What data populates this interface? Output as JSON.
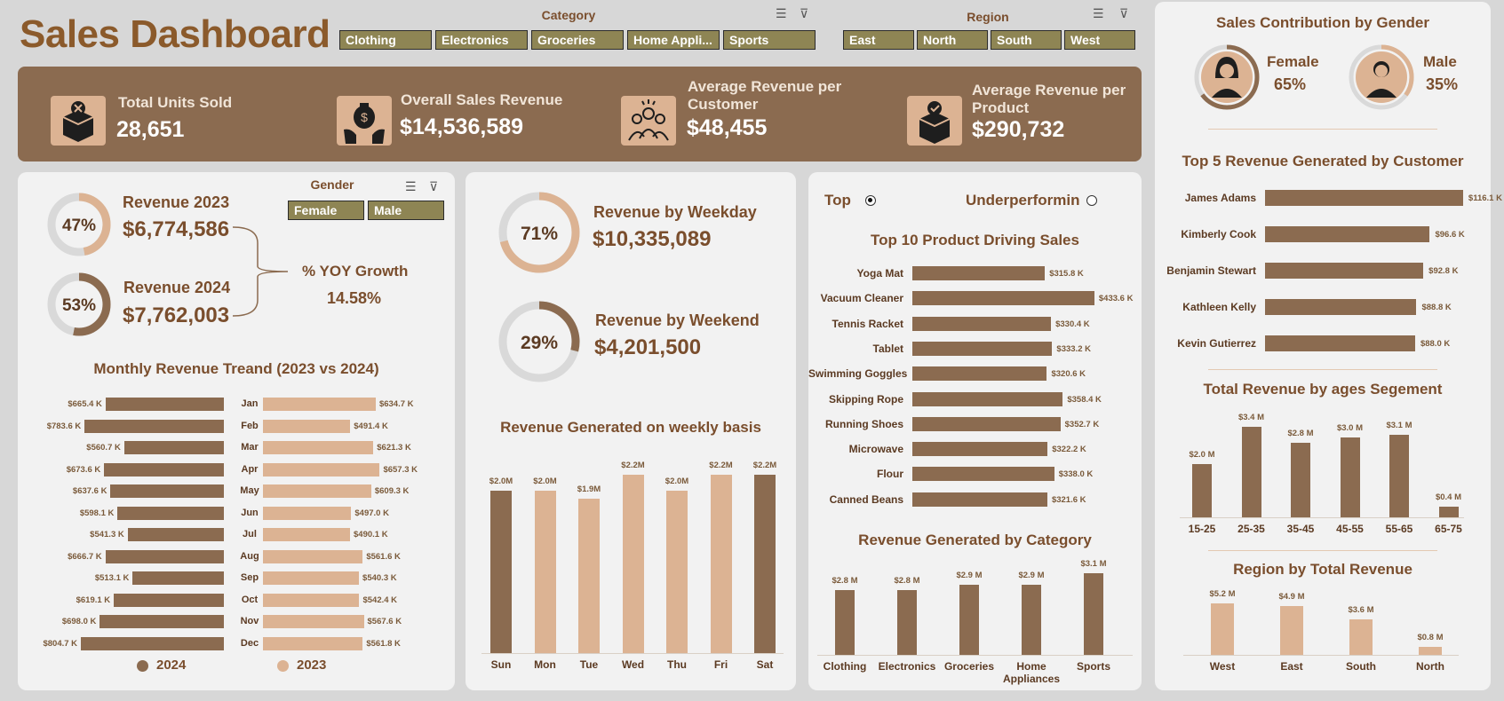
{
  "header": {
    "title": "Sales Dashboard"
  },
  "slicers": {
    "category": {
      "title": "Category",
      "items": [
        "Clothing",
        "Electronics",
        "Groceries",
        "Home Appli...",
        "Sports"
      ]
    },
    "region": {
      "title": "Region",
      "items": [
        "East",
        "North",
        "South",
        "West"
      ]
    },
    "gender": {
      "title": "Gender",
      "items": [
        "Female",
        "Male"
      ]
    }
  },
  "kpis": [
    {
      "label": "Total Units Sold",
      "value": "28,651",
      "icon": "box-cancel-icon"
    },
    {
      "label": "Overall Sales Revenue",
      "value": "$14,536,589",
      "icon": "money-bag-hands-icon"
    },
    {
      "label": "Average Revenue per Customer",
      "value": "$48,455",
      "icon": "customers-group-icon"
    },
    {
      "label": "Average Revenue per Product",
      "value": "$290,732",
      "icon": "box-check-icon"
    }
  ],
  "revenue_years": {
    "y2023": {
      "label": "Revenue 2023",
      "value": "$6,774,586",
      "pct": "47%",
      "fraction": 0.47
    },
    "y2024": {
      "label": "Revenue 2024",
      "value": "$7,762,003",
      "pct": "53%",
      "fraction": 0.53
    },
    "yoy": {
      "label": "%  YOY Growth",
      "value": "14.58%"
    }
  },
  "monthly": {
    "title": "Monthly Revenue Treand  (2023 vs 2024)",
    "legend": {
      "a": "2024",
      "b": "2023"
    },
    "chart_data": {
      "type": "bar",
      "categories": [
        "Jan",
        "Feb",
        "Mar",
        "Apr",
        "May",
        "Jun",
        "Jul",
        "Aug",
        "Sep",
        "Oct",
        "Nov",
        "Dec"
      ],
      "series": [
        {
          "name": "2024",
          "values": [
            665.4,
            783.6,
            560.7,
            673.6,
            637.6,
            598.1,
            541.3,
            666.7,
            513.1,
            619.1,
            698.0,
            804.7
          ],
          "labels": [
            "$665.4 K",
            "$783.6 K",
            "$560.7 K",
            "$673.6 K",
            "$637.6 K",
            "$598.1 K",
            "$541.3 K",
            "$666.7 K",
            "$513.1 K",
            "$619.1 K",
            "$698.0 K",
            "$804.7 K"
          ]
        },
        {
          "name": "2023",
          "values": [
            634.7,
            491.4,
            621.3,
            657.3,
            609.3,
            497.0,
            490.1,
            561.6,
            540.3,
            542.4,
            567.6,
            561.8
          ],
          "labels": [
            "$634.7 K",
            "$491.4 K",
            "$621.3 K",
            "$657.3 K",
            "$609.3 K",
            "$497.0 K",
            "$490.1 K",
            "$561.6 K",
            "$540.3 K",
            "$542.4 K",
            "$567.6 K",
            "$561.8 K"
          ]
        }
      ]
    }
  },
  "weekday": {
    "label": "Revenue by Weekday",
    "value": "$10,335,089",
    "pct": "71%",
    "fraction": 0.71
  },
  "weekend": {
    "label": "Revenue by Weekend",
    "value": "$4,201,500",
    "pct": "29%",
    "fraction": 0.29
  },
  "weekly": {
    "title": "Revenue Generated on weekly basis",
    "chart_data": {
      "type": "bar",
      "categories": [
        "Sun",
        "Mon",
        "Tue",
        "Wed",
        "Thu",
        "Fri",
        "Sat"
      ],
      "values": [
        2.0,
        2.0,
        1.9,
        2.2,
        2.0,
        2.2,
        2.2
      ],
      "labels": [
        "$2.0M",
        "$2.0M",
        "$1.9M",
        "$2.2M",
        "$2.0M",
        "$2.2M",
        "$2.2M"
      ],
      "colors": [
        "dark",
        "light",
        "light",
        "light",
        "light",
        "light",
        "dark"
      ]
    }
  },
  "products": {
    "toggle_top": "Top",
    "toggle_under": "Underperformin",
    "title": "Top 10 Product Driving Sales",
    "chart_data": {
      "type": "bar",
      "categories": [
        "Yoga Mat",
        "Vacuum Cleaner",
        "Tennis Racket",
        "Tablet",
        "Swimming Goggles",
        "Skipping Rope",
        "Running Shoes",
        "Microwave",
        "Flour",
        "Canned Beans"
      ],
      "values": [
        315.8,
        433.6,
        330.4,
        333.2,
        320.6,
        358.4,
        352.7,
        322.2,
        338.0,
        321.6
      ],
      "labels": [
        "$315.8 K",
        "$433.6 K",
        "$330.4 K",
        "$333.2 K",
        "$320.6 K",
        "$358.4 K",
        "$352.7 K",
        "$322.2 K",
        "$338.0 K",
        "$321.6 K"
      ]
    }
  },
  "category_rev": {
    "title": "Revenue Generated by Category",
    "chart_data": {
      "type": "bar",
      "categories": [
        "Clothing",
        "Electronics",
        "Groceries",
        "Home Appliances",
        "Sports"
      ],
      "values": [
        2.8,
        2.8,
        2.9,
        2.9,
        3.1
      ],
      "labels": [
        "$2.8 M",
        "$2.8 M",
        "$2.9 M",
        "$2.9 M",
        "$3.1 M"
      ]
    }
  },
  "gender_contrib": {
    "title": "Sales Contribution by Gender",
    "female": {
      "label": "Female",
      "pct": "65%",
      "fraction": 0.65
    },
    "male": {
      "label": "Male",
      "pct": "35%",
      "fraction": 0.35
    }
  },
  "top_customers": {
    "title": "Top 5 Revenue Generated by Customer",
    "chart_data": {
      "type": "bar",
      "categories": [
        "James Adams",
        "Kimberly Cook",
        "Benjamin Stewart",
        "Kathleen Kelly",
        "Kevin Gutierrez"
      ],
      "values": [
        116.1,
        96.6,
        92.8,
        88.8,
        88.0
      ],
      "labels": [
        "$116.1 K",
        "$96.6 K",
        "$92.8 K",
        "$88.8 K",
        "$88.0 K"
      ]
    }
  },
  "ages": {
    "title": "Total Revenue by ages Segement",
    "chart_data": {
      "type": "bar",
      "categories": [
        "15-25",
        "25-35",
        "35-45",
        "45-55",
        "55-65",
        "65-75"
      ],
      "values": [
        2.0,
        3.4,
        2.8,
        3.0,
        3.1,
        0.4
      ],
      "labels": [
        "$2.0 M",
        "$3.4 M",
        "$2.8 M",
        "$3.0 M",
        "$3.1 M",
        "$0.4 M"
      ]
    }
  },
  "regions": {
    "title": "Region by Total Revenue",
    "chart_data": {
      "type": "bar",
      "categories": [
        "West",
        "East",
        "South",
        "North"
      ],
      "values": [
        5.2,
        4.9,
        3.6,
        0.8
      ],
      "labels": [
        "$5.2 M",
        "$4.9 M",
        "$3.6 M",
        "$0.8 M"
      ]
    }
  },
  "colors": {
    "dark": "#8b6b50",
    "light": "#dcb393",
    "text": "#7a4e2d",
    "ring": "#d9d9d9"
  }
}
